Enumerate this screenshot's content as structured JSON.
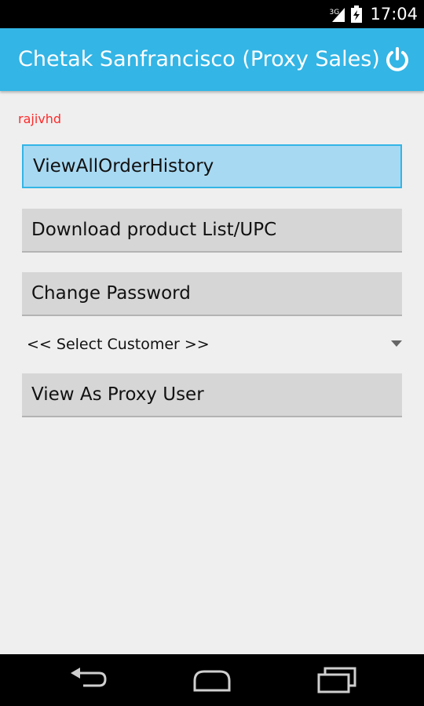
{
  "status_bar": {
    "network": "3G",
    "time": "17:04",
    "icons": [
      "signal-icon",
      "battery-icon"
    ]
  },
  "action_bar": {
    "title": "Chetak Sanfrancisco (Proxy Sales)",
    "action_icon": "power-icon"
  },
  "user": {
    "name": "rajivhd",
    "color": "#ff2a2a"
  },
  "buttons": {
    "view_all_order_history": "ViewAllOrderHistory",
    "download_product_list": "Download product List/UPC",
    "change_password": "Change Password",
    "view_as_proxy_user": "View As Proxy User"
  },
  "customer_select": {
    "selected": "<< Select Customer >>"
  },
  "nav_bar": {
    "icons": [
      "back-icon",
      "home-icon",
      "recent-apps-icon"
    ]
  },
  "colors": {
    "accent": "#33b5e5",
    "focused_button": "#a8d9f2",
    "button": "#d6d6d6",
    "background": "#efefef"
  }
}
